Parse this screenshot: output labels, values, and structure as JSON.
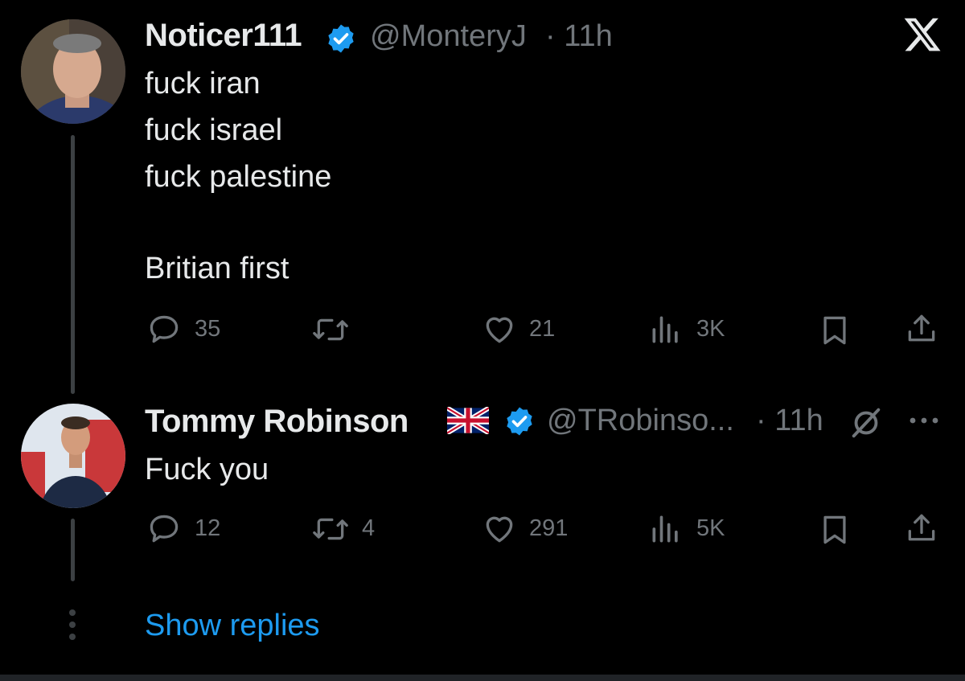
{
  "colors": {
    "background": "#000000",
    "text": "#e7e9ea",
    "muted": "#71767b",
    "accent": "#1d9bf0",
    "verified": "#1d9bf0"
  },
  "header": {
    "close_icon": "x-logo-icon"
  },
  "tweet1": {
    "display_name": "Noticer111",
    "verified": true,
    "handle": "@MonteryJ",
    "time": "· 11h",
    "lines": [
      "fuck iran",
      "fuck israel",
      "fuck palestine",
      "",
      "Britian first"
    ],
    "replies": "35",
    "reposts": "",
    "likes": "21",
    "views": "3K"
  },
  "tweet2": {
    "display_name": "Tommy Robinson",
    "flag": "uk-flag",
    "verified": true,
    "handle": "@TRobinso...",
    "time": "· 11h",
    "status_icon": "muted-circle-slash-icon",
    "more_icon": "more-dots-icon",
    "lines": [
      "Fuck you"
    ],
    "replies": "12",
    "reposts": "4",
    "likes": "291",
    "views": "5K"
  },
  "show_replies": "Show replies"
}
